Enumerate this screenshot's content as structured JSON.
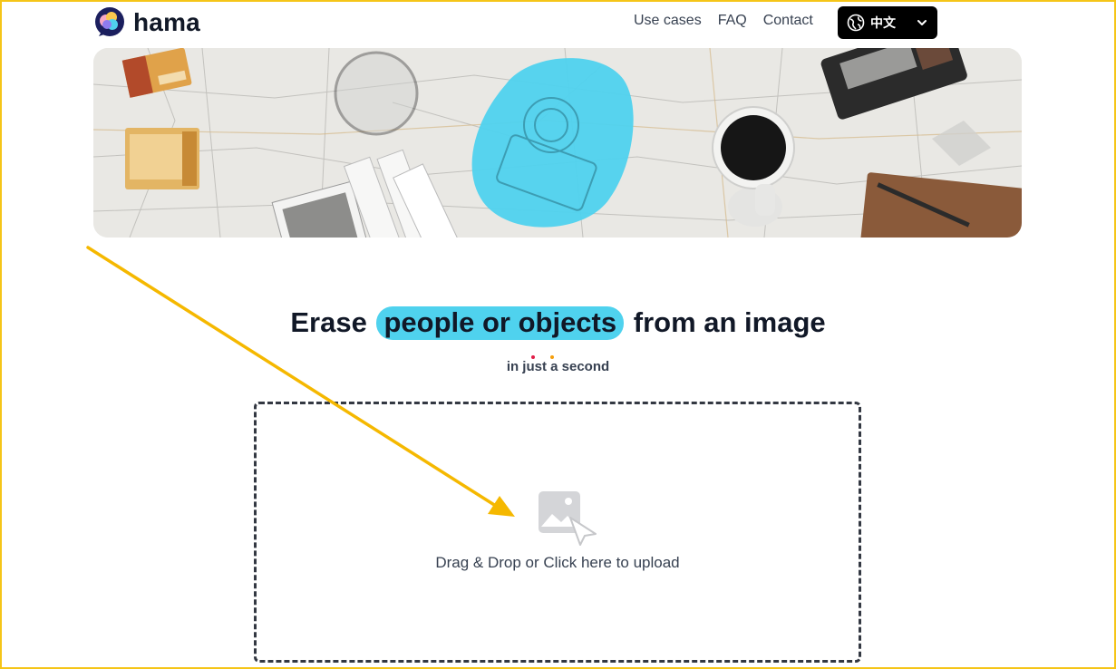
{
  "brand": {
    "name": "hama",
    "logo_icon": "hama-logo-icon"
  },
  "nav": {
    "items": [
      "Use cases",
      "FAQ",
      "Contact"
    ],
    "language": {
      "label": "中文",
      "icon": "globe-icon",
      "dropdown_icon": "chevron-down-icon"
    }
  },
  "hero": {
    "image_alt": ""
  },
  "headline": {
    "prefix": "Erase",
    "highlight": "people or objects",
    "suffix": "from an image",
    "subtitle": "in just a second"
  },
  "upload": {
    "label": "Drag & Drop or Click here to upload",
    "icon": "image-upload-icon"
  },
  "colors": {
    "highlight": "#4fd2ee",
    "frame": "#f5c518",
    "arrow": "#f5b800",
    "language_button": "#000000"
  }
}
